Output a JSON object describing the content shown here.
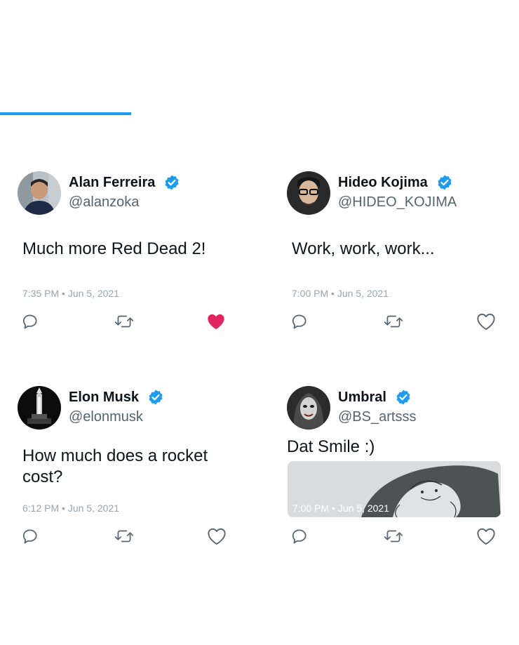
{
  "colors": {
    "accent": "#1d9bf0",
    "liked": "#f91880",
    "secondary_text": "#536471",
    "muted_text": "#9aa4ad"
  },
  "tweets": [
    {
      "name": "Alan Ferreira",
      "handle": "@alanzoka",
      "verified": true,
      "text": "Much more Red Dead 2!",
      "timestamp": "7:35 PM • Jun 5, 2021",
      "liked": true,
      "icons": [
        "reply-icon",
        "retweet-icon",
        "like-filled-icon"
      ]
    },
    {
      "name": "Hideo Kojima",
      "handle": "@HIDEO_KOJIMA",
      "verified": true,
      "text": "Work, work, work...",
      "timestamp": "7:00 PM • Jun 5, 2021",
      "liked": false,
      "icons": [
        "reply-icon",
        "retweet-icon",
        "like-icon"
      ]
    },
    {
      "name": "Elon Musk",
      "handle": "@elonmusk",
      "verified": true,
      "text": "How much does a rocket cost?",
      "timestamp": "6:12 PM • Jun 5, 2021",
      "liked": false,
      "icons": [
        "reply-icon",
        "retweet-icon",
        "like-icon"
      ]
    },
    {
      "name": "Umbral",
      "handle": "@BS_artsss",
      "verified": true,
      "text": "Dat Smile :)",
      "timestamp": "7:00 PM • Jun 5, 2021",
      "liked": false,
      "has_media": true,
      "icons": [
        "reply-icon",
        "retweet-icon",
        "like-icon"
      ]
    }
  ]
}
